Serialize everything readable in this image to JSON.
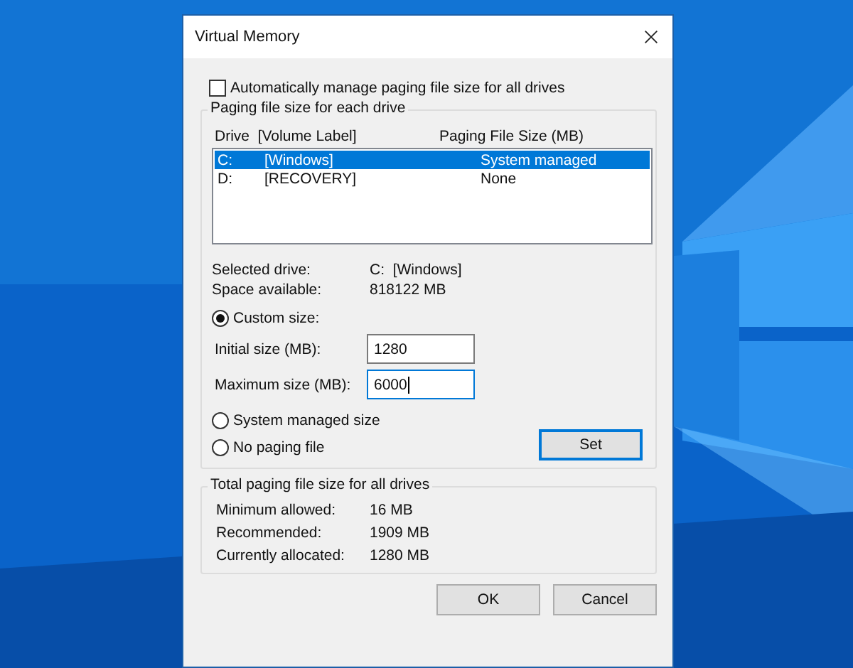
{
  "window": {
    "title": "Virtual Memory"
  },
  "auto_manage": {
    "label": "Automatically manage paging file size for all drives",
    "checked": false
  },
  "drives_group": {
    "title": "Paging file size for each drive",
    "columns": [
      "Drive  [Volume Label]",
      "Paging File Size (MB)"
    ],
    "rows": [
      {
        "drive": "C:",
        "label": "[Windows]",
        "size": "System managed",
        "selected": true
      },
      {
        "drive": "D:",
        "label": "[RECOVERY]",
        "size": "None",
        "selected": false
      }
    ],
    "info": [
      {
        "label": "Selected drive:",
        "value": "C:  [Windows]"
      },
      {
        "label": "Space available:",
        "value": "818122 MB"
      }
    ],
    "options": [
      {
        "kind": "custom",
        "label": "Custom size:",
        "selected": true
      },
      {
        "kind": "system",
        "label": "System managed size",
        "selected": false
      },
      {
        "kind": "none",
        "label": "No paging file",
        "selected": false
      }
    ],
    "fields": [
      {
        "label": "Initial size (MB):",
        "value": "1280",
        "focused": false
      },
      {
        "label": "Maximum size (MB):",
        "value": "6000",
        "focused": true
      }
    ],
    "set_button": "Set"
  },
  "totals_group": {
    "title": "Total paging file size for all drives",
    "rows": [
      {
        "label": "Minimum allowed:",
        "value": "16 MB"
      },
      {
        "label": "Recommended:",
        "value": "1909 MB"
      },
      {
        "label": "Currently allocated:",
        "value": "1280 MB"
      }
    ]
  },
  "buttons": [
    "OK",
    "Cancel"
  ]
}
